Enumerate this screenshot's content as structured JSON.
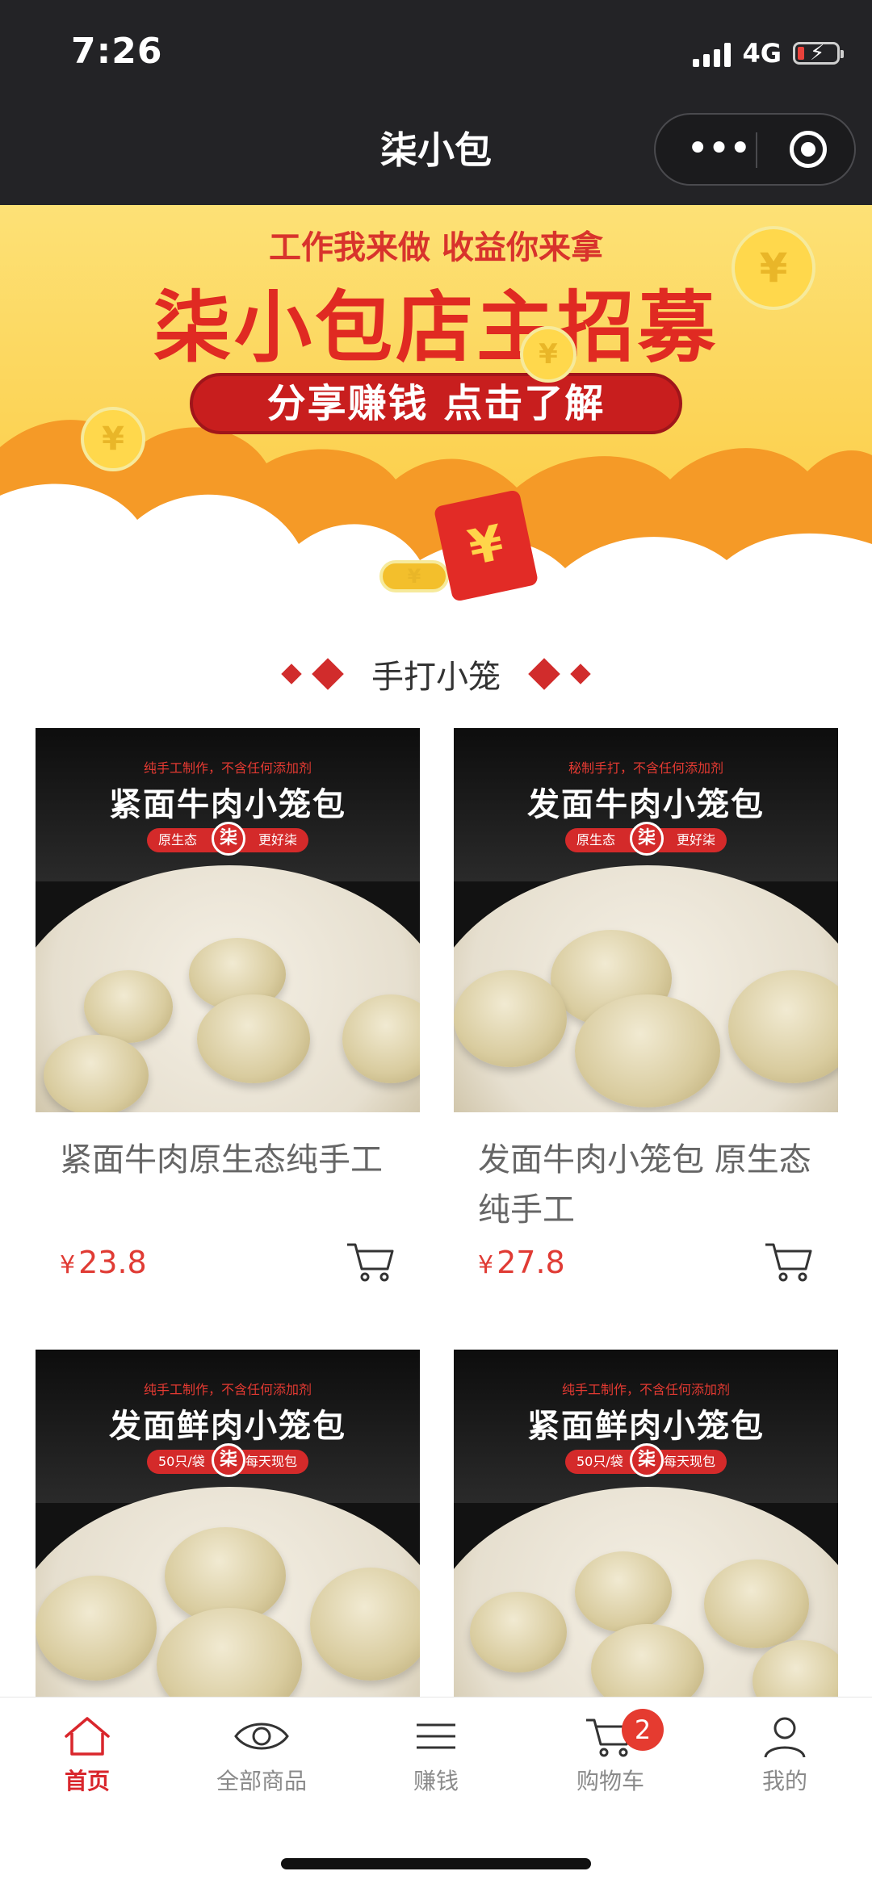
{
  "status_bar": {
    "time": "7:26",
    "network": "4G",
    "battery_level": 0.15,
    "battery_color": "#e9423b"
  },
  "header": {
    "title": "柒小包",
    "menu_icon": "more-dots-icon",
    "close_icon": "target-icon"
  },
  "banner": {
    "subtitle": "工作我来做 收益你来拿",
    "title": "柒小包店主招募",
    "button_label": "分享赚钱 点击了解",
    "envelope_symbol": "¥",
    "coin_symbol": "¥"
  },
  "section": {
    "title": "手打小笼"
  },
  "products": [
    {
      "image": {
        "top_line": "纯手工制作，不含任何添加剂",
        "name": "紧面牛肉小笼包",
        "pill_left": "原生态",
        "pill_right": "更好柒",
        "seal": "柒"
      },
      "name": "紧面牛肉原生态纯手工",
      "currency": "¥",
      "price": "23.8"
    },
    {
      "image": {
        "top_line": "秘制手打，不含任何添加剂",
        "name": "发面牛肉小笼包",
        "pill_left": "原生态",
        "pill_right": "更好柒",
        "seal": "柒"
      },
      "name": "发面牛肉小笼包 原生态纯手工",
      "currency": "¥",
      "price": "27.8"
    },
    {
      "image": {
        "top_line": "纯手工制作，不含任何添加剂",
        "name": "发面鲜肉小笼包",
        "pill_left": "50只/袋",
        "pill_right": "每天现包",
        "seal": "柒"
      }
    },
    {
      "image": {
        "top_line": "纯手工制作，不含任何添加剂",
        "name": "紧面鲜肉小笼包",
        "pill_left": "50只/袋",
        "pill_right": "每天现包",
        "seal": "柒"
      }
    }
  ],
  "tabbar": {
    "accent": "#d9262c",
    "items": [
      {
        "label": "首页",
        "icon": "home-icon",
        "active": true
      },
      {
        "label": "全部商品",
        "icon": "eye-icon",
        "active": false
      },
      {
        "label": "赚钱",
        "icon": "menu-lines-icon",
        "active": false
      },
      {
        "label": "购物车",
        "icon": "cart-icon",
        "active": false,
        "badge": "2"
      },
      {
        "label": "我的",
        "icon": "user-icon",
        "active": false
      }
    ]
  }
}
